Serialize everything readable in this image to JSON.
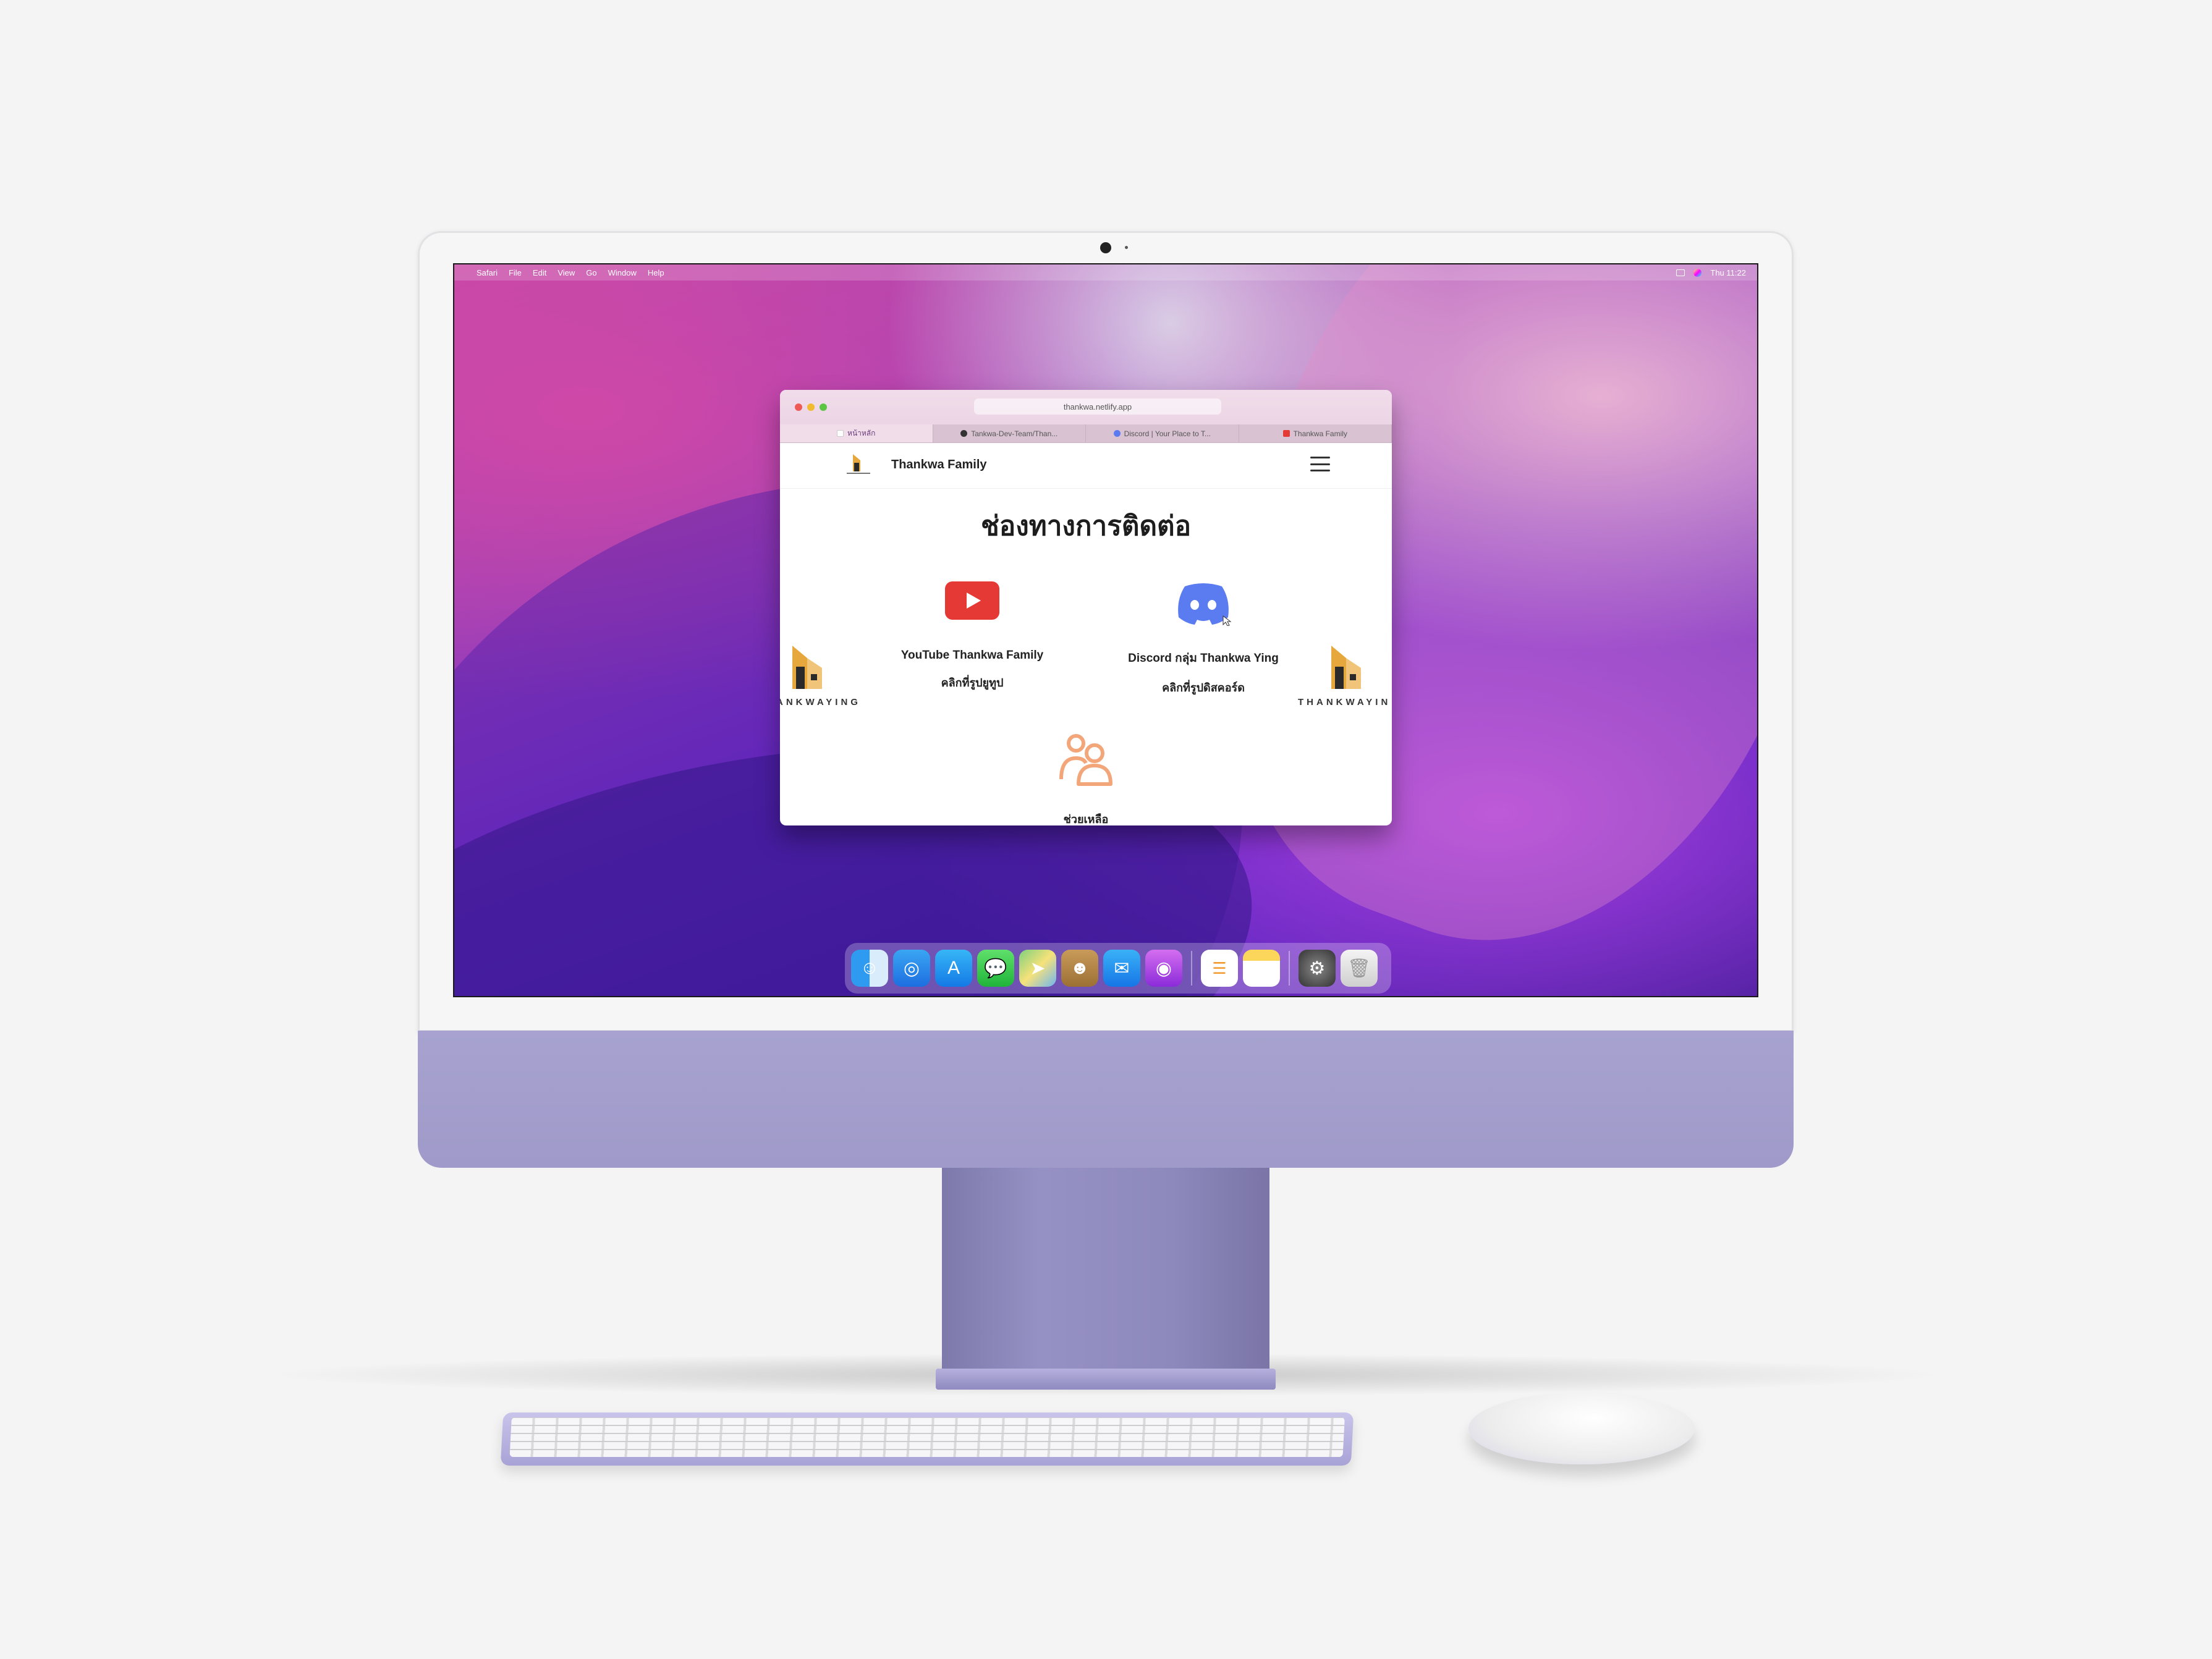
{
  "menubar": {
    "apple_symbol": "",
    "items": [
      "Safari",
      "File",
      "Edit",
      "View",
      "Go",
      "Window",
      "Help"
    ],
    "clock": "Thu 11:22"
  },
  "browser": {
    "url": "thankwa.netlify.app",
    "tabs": [
      {
        "label": "หน้าหลัก",
        "active": true
      },
      {
        "label": "Tankwa-Dev-Team/Than...",
        "active": false
      },
      {
        "label": "Discord | Your Place to T...",
        "active": false
      },
      {
        "label": "Thankwa Family",
        "active": false
      }
    ]
  },
  "site": {
    "title": "Thankwa Family",
    "heading": "ช่องทางการติดต่อ",
    "youtube": {
      "label": "YouTube Thankwa Family",
      "sub": "คลิกที่รูปยูทูป"
    },
    "discord": {
      "label": "Discord กลุ่ม Thankwa Ying",
      "sub": "คลิกที่รูปดิสคอร์ด"
    },
    "brand_left": "ANKWAYING",
    "brand_right": "THANKWAYIN",
    "help": "ช่วยเหลือ"
  },
  "dock": {
    "apps": [
      "finder-icon",
      "safari-icon",
      "app-store-icon",
      "messages-icon",
      "maps-icon",
      "contacts-icon",
      "mail-icon",
      "podcasts-icon",
      "reminders-icon",
      "notes-icon",
      "system-preferences-icon",
      "trash-icon"
    ]
  },
  "colors": {
    "youtube": "#e53935",
    "discord": "#5b7cf0",
    "help": "#f2a67a",
    "chin": "#a7a2cf"
  }
}
